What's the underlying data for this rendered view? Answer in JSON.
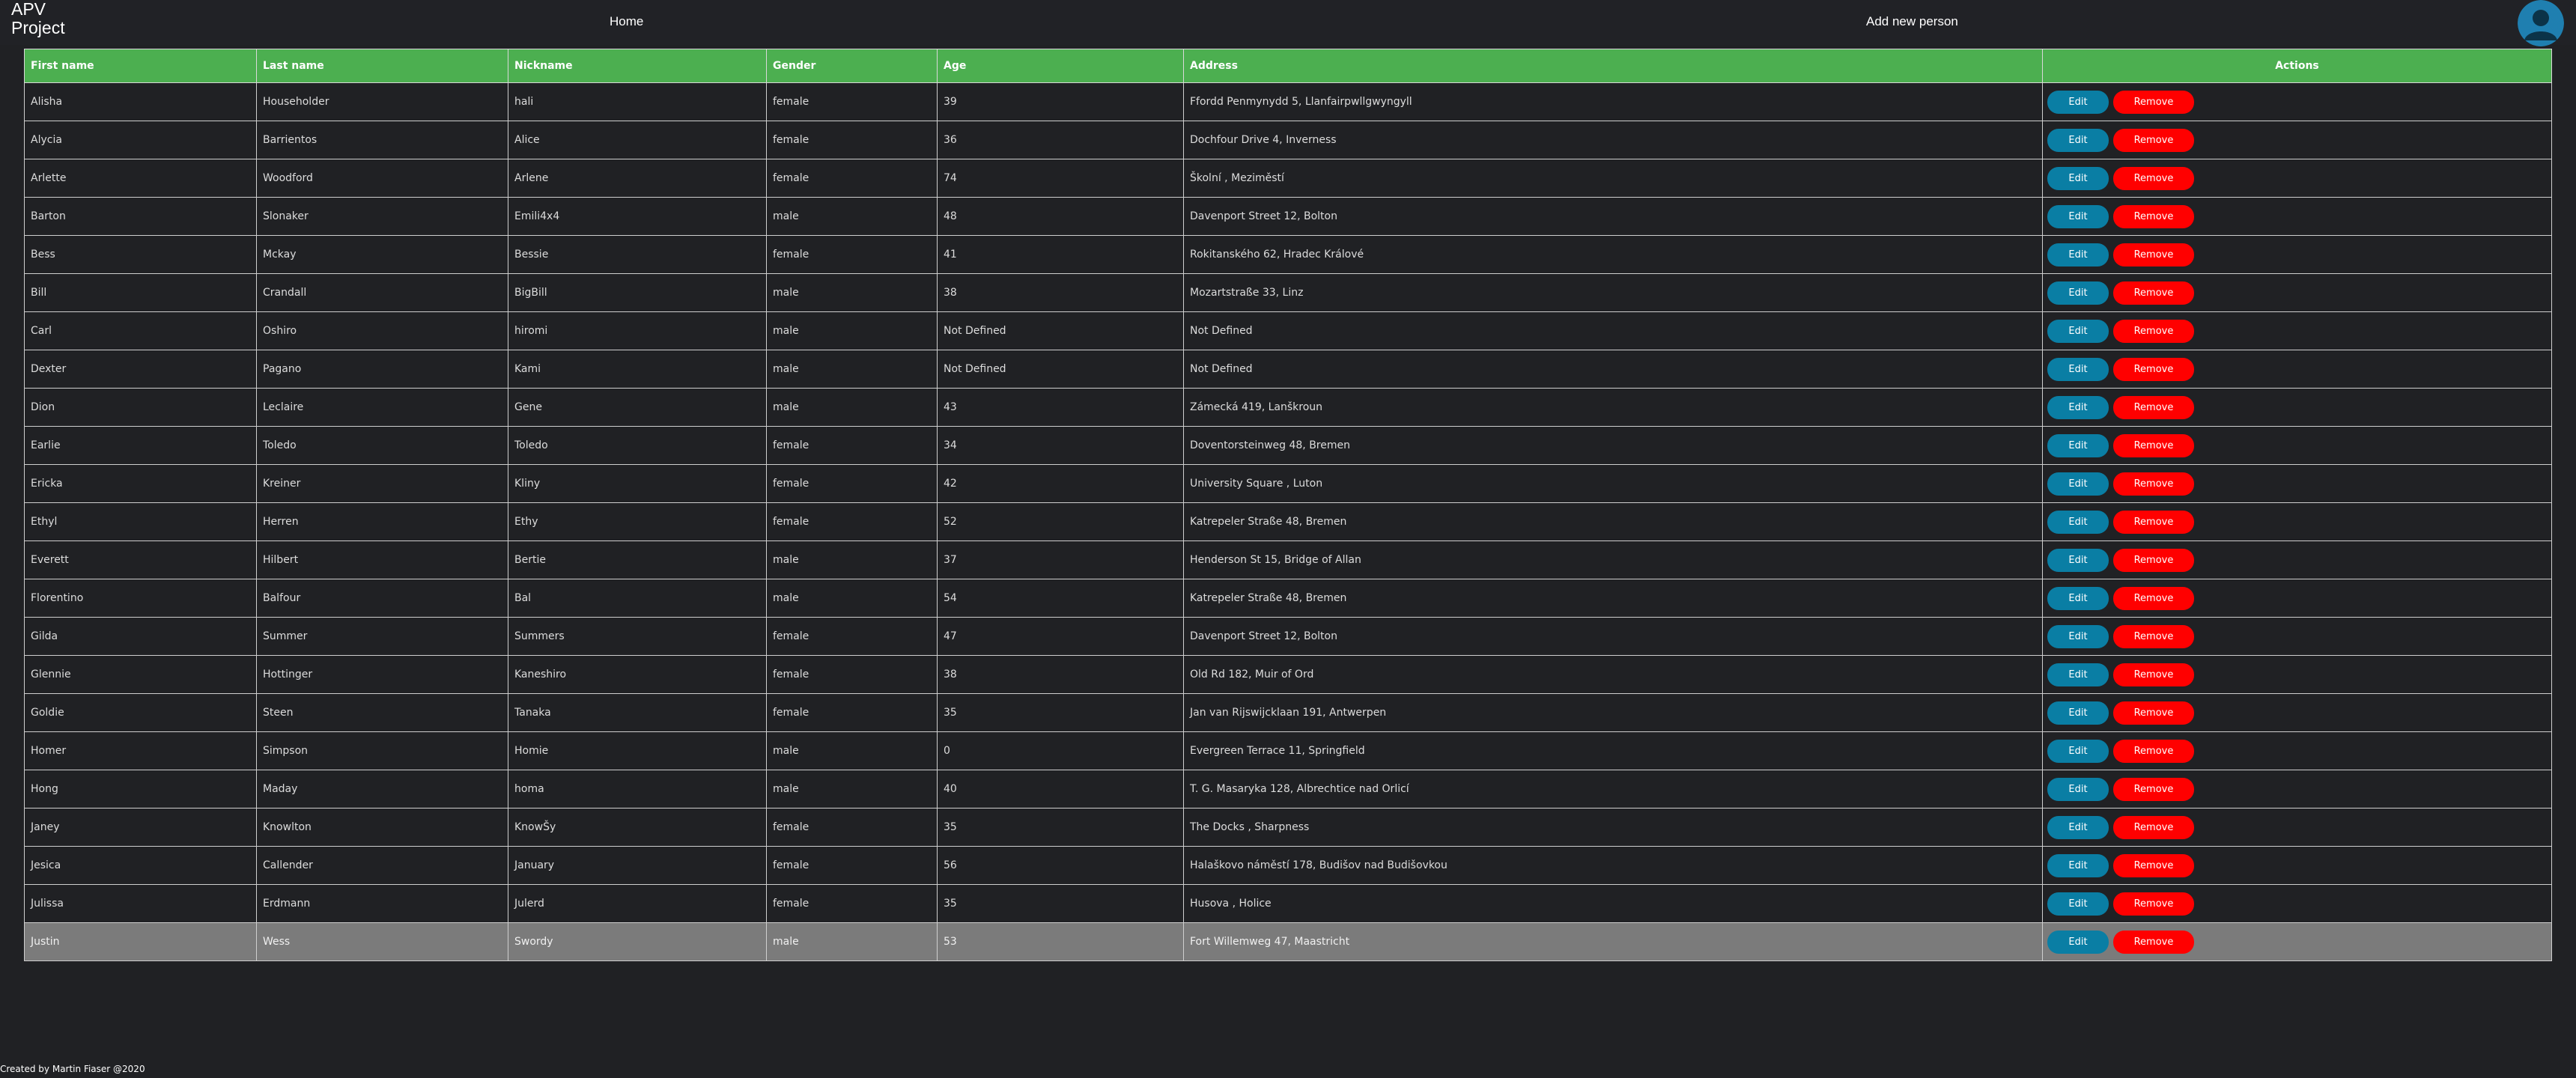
{
  "navbar": {
    "brand": "APV Project",
    "home_label": "Home",
    "add_label": "Add new person",
    "avatar_icon": "user-avatar-icon",
    "avatar_color": "#1f7fb0"
  },
  "table": {
    "header_color": "#4caf50",
    "columns": [
      "First name",
      "Last name",
      "Nickname",
      "Gender",
      "Age",
      "Address",
      "Actions"
    ],
    "edit_label": "Edit",
    "remove_label": "Remove",
    "edit_color": "#0a7ea4",
    "remove_color": "#ff0000",
    "rows": [
      {
        "first": "Alisha",
        "last": "Householder",
        "nick": "hali",
        "gender": "female",
        "age": "39",
        "address": "Ffordd Penmynydd 5, Llanfairpwllgwyngyll"
      },
      {
        "first": "Alycia",
        "last": "Barrientos",
        "nick": "Alice",
        "gender": "female",
        "age": "36",
        "address": "Dochfour Drive 4, Inverness"
      },
      {
        "first": "Arlette",
        "last": "Woodford",
        "nick": "Arlene",
        "gender": "female",
        "age": "74",
        "address": "Školní , Meziměstí"
      },
      {
        "first": "Barton",
        "last": "Slonaker",
        "nick": "Emili4x4",
        "gender": "male",
        "age": "48",
        "address": "Davenport Street 12, Bolton"
      },
      {
        "first": "Bess",
        "last": "Mckay",
        "nick": "Bessie",
        "gender": "female",
        "age": "41",
        "address": "Rokitanského 62, Hradec Králové"
      },
      {
        "first": "Bill",
        "last": "Crandall",
        "nick": "BigBill",
        "gender": "male",
        "age": "38",
        "address": "Mozartstraße 33, Linz"
      },
      {
        "first": "Carl",
        "last": "Oshiro",
        "nick": "hiromi",
        "gender": "male",
        "age": "Not Defined",
        "address": "Not Defined"
      },
      {
        "first": "Dexter",
        "last": "Pagano",
        "nick": "Kami",
        "gender": "male",
        "age": "Not Defined",
        "address": "Not Defined"
      },
      {
        "first": "Dion",
        "last": "Leclaire",
        "nick": "Gene",
        "gender": "male",
        "age": "43",
        "address": "Zámecká 419, Lanškroun"
      },
      {
        "first": "Earlie",
        "last": "Toledo",
        "nick": "Toledo",
        "gender": "female",
        "age": "34",
        "address": "Doventorsteinweg 48, Bremen"
      },
      {
        "first": "Ericka",
        "last": "Kreiner",
        "nick": "Kliny",
        "gender": "female",
        "age": "42",
        "address": "University Square , Luton"
      },
      {
        "first": "Ethyl",
        "last": "Herren",
        "nick": "Ethy",
        "gender": "female",
        "age": "52",
        "address": "Katrepeler Straße 48, Bremen"
      },
      {
        "first": "Everett",
        "last": "Hilbert",
        "nick": "Bertie",
        "gender": "male",
        "age": "37",
        "address": "Henderson St 15, Bridge of Allan"
      },
      {
        "first": "Florentino",
        "last": "Balfour",
        "nick": "Bal",
        "gender": "male",
        "age": "54",
        "address": "Katrepeler Straße 48, Bremen"
      },
      {
        "first": "Gilda",
        "last": "Summer",
        "nick": "Summers",
        "gender": "female",
        "age": "47",
        "address": "Davenport Street 12, Bolton"
      },
      {
        "first": "Glennie",
        "last": "Hottinger",
        "nick": "Kaneshiro",
        "gender": "female",
        "age": "38",
        "address": "Old Rd 182, Muir of Ord"
      },
      {
        "first": "Goldie",
        "last": "Steen",
        "nick": "Tanaka",
        "gender": "female",
        "age": "35",
        "address": "Jan van Rijswijcklaan 191, Antwerpen"
      },
      {
        "first": "Homer",
        "last": "Simpson",
        "nick": "Homie",
        "gender": "male",
        "age": "0",
        "address": "Evergreen Terrace 11, Springfield"
      },
      {
        "first": "Hong",
        "last": "Maday",
        "nick": "homa",
        "gender": "male",
        "age": "40",
        "address": "T. G. Masaryka 128, Albrechtice nad Orlicí"
      },
      {
        "first": "Janey",
        "last": "Knowlton",
        "nick": "KnowŠy",
        "gender": "female",
        "age": "35",
        "address": "The Docks , Sharpness"
      },
      {
        "first": "Jesica",
        "last": "Callender",
        "nick": "January",
        "gender": "female",
        "age": "56",
        "address": "Halaškovo náměstí 178, Budišov nad Budišovkou"
      },
      {
        "first": "Julissa",
        "last": "Erdmann",
        "nick": "Julerd",
        "gender": "female",
        "age": "35",
        "address": "Husova , Holice"
      },
      {
        "first": "Justin",
        "last": "Wess",
        "nick": "Swordy",
        "gender": "male",
        "age": "53",
        "address": "Fort Willemweg 47, Maastricht"
      }
    ]
  },
  "footer": {
    "text": "Created by Martin Fiaser @2020"
  }
}
